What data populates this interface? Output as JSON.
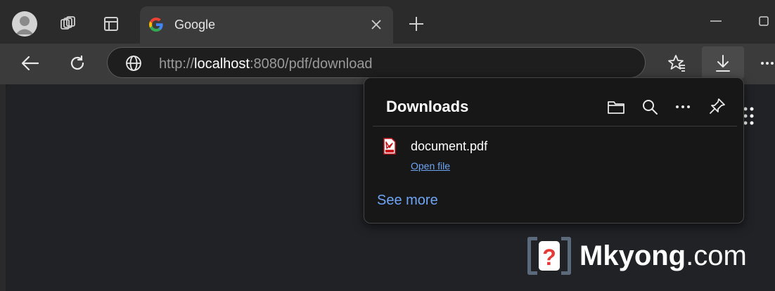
{
  "tab": {
    "title": "Google"
  },
  "address": {
    "prefix": "http://",
    "host": "localhost",
    "rest": ":8080/pdf/download"
  },
  "downloads": {
    "title": "Downloads",
    "file": {
      "name": "document.pdf",
      "action": "Open file"
    },
    "see_more": "See more"
  },
  "watermark": {
    "brand": "Mkyong",
    "suffix": ".com"
  },
  "colors": {
    "link": "#6ea5f5",
    "pdf_icon": "#c4161c",
    "accent_red": "#e53935"
  }
}
